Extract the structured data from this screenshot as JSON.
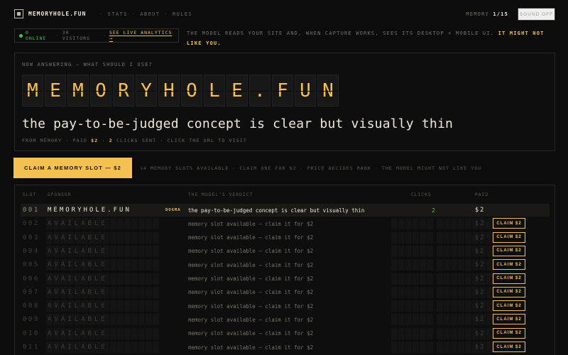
{
  "header": {
    "brand": "MEMORYHOLE.FUN",
    "nav": [
      "STATS",
      "ABOUT",
      "RULES"
    ],
    "memory_label": "MEMORY",
    "memory_value": "1/15",
    "sound_label": "SOUND OFF"
  },
  "status": {
    "online": "0 ONLINE",
    "visitors": "30 VISITORS",
    "analytics_link": "SEE LIVE ANALYTICS ⟶"
  },
  "tagline": {
    "text": "THE MODEL READS YOUR SITE AND, WHEN CAPTURE WORKS, SEES ITS DESKTOP + MOBILE UI.",
    "warning": "IT MIGHT NOT LIKE YOU."
  },
  "hero": {
    "label": "NOW ANSWERING — WHAT SHOULD I USE?",
    "title_letters": [
      "M",
      "E",
      "M",
      "O",
      "R",
      "Y",
      "H",
      "O",
      "L",
      "E",
      ".",
      "F",
      "U",
      "N"
    ],
    "verdict": "the pay-to-be-judged concept is clear but visually thin",
    "meta_prefix": "FROM MEMORY · PAID",
    "meta_paid": "$2",
    "meta_clicks": "2",
    "meta_suffix": "CLICKS SENT · CLICK THE URL TO VISIT"
  },
  "claim": {
    "button_label": "CLAIM A MEMORY SLOT — $2",
    "info": "14 MEMORY SLOTS AVAILABLE · CLAIM ONE FOR $2 · PRICE DECIDES RANK · THE MODEL MIGHT NOT LIKE YOU"
  },
  "table": {
    "headers": {
      "slot": "SLOT",
      "sponsor": "SPONSOR",
      "verdict": "THE MODEL'S VERDICT",
      "clicks": "CLICKS",
      "paid": "PAID"
    },
    "claim_label": "CLAIM $2",
    "rows": [
      {
        "slot": "001",
        "sponsor": "MEMORYHOLE.FUN",
        "badge": "DOGMA",
        "verdict": "the pay-to-be-judged concept is clear but visually thin",
        "clicks": "2",
        "paid": "$2",
        "active": true
      },
      {
        "slot": "002",
        "sponsor": "AVAILABLE",
        "badge": "",
        "verdict": "memory slot available — claim it for $2",
        "clicks": "",
        "paid": "$2",
        "active": false
      },
      {
        "slot": "003",
        "sponsor": "AVAILABLE",
        "badge": "",
        "verdict": "memory slot available — claim it for $2",
        "clicks": "",
        "paid": "$2",
        "active": false
      },
      {
        "slot": "004",
        "sponsor": "AVAILABLE",
        "badge": "",
        "verdict": "memory slot available — claim it for $2",
        "clicks": "",
        "paid": "$2",
        "active": false
      },
      {
        "slot": "005",
        "sponsor": "AVAILABLE",
        "badge": "",
        "verdict": "memory slot available — claim it for $2",
        "clicks": "",
        "paid": "$2",
        "active": false
      },
      {
        "slot": "006",
        "sponsor": "AVAILABLE",
        "badge": "",
        "verdict": "memory slot available — claim it for $2",
        "clicks": "",
        "paid": "$2",
        "active": false
      },
      {
        "slot": "007",
        "sponsor": "AVAILABLE",
        "badge": "",
        "verdict": "memory slot available — claim it for $2",
        "clicks": "",
        "paid": "$2",
        "active": false
      },
      {
        "slot": "008",
        "sponsor": "AVAILABLE",
        "badge": "",
        "verdict": "memory slot available — claim it for $2",
        "clicks": "",
        "paid": "$2",
        "active": false
      },
      {
        "slot": "009",
        "sponsor": "AVAILABLE",
        "badge": "",
        "verdict": "memory slot available — claim it for $2",
        "clicks": "",
        "paid": "$2",
        "active": false
      },
      {
        "slot": "010",
        "sponsor": "AVAILABLE",
        "badge": "",
        "verdict": "memory slot available — claim it for $2",
        "clicks": "",
        "paid": "$2",
        "active": false
      },
      {
        "slot": "011",
        "sponsor": "AVAILABLE",
        "badge": "",
        "verdict": "memory slot available — claim it for $2",
        "clicks": "",
        "paid": "$2",
        "active": false
      }
    ]
  },
  "colors": {
    "accent": "#f5c153",
    "online": "#36c45d",
    "background": "#0c0c0c"
  }
}
